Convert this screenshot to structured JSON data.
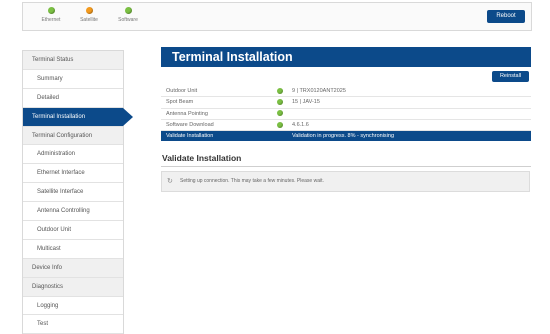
{
  "header": {
    "indicators": [
      {
        "label": "Ethernet",
        "color": "#7bc043"
      },
      {
        "label": "Satellite",
        "color": "#f39a1e"
      },
      {
        "label": "Software",
        "color": "#7bc043"
      }
    ],
    "reboot_label": "Reboot"
  },
  "sidebar": {
    "items": [
      {
        "label": "Terminal Status"
      },
      {
        "label": "Summary"
      },
      {
        "label": "Detailed"
      },
      {
        "label": "Terminal Installation"
      },
      {
        "label": "Terminal Configuration"
      },
      {
        "label": "Administration"
      },
      {
        "label": "Ethernet Interface"
      },
      {
        "label": "Satellite Interface"
      },
      {
        "label": "Antenna Controlling"
      },
      {
        "label": "Outdoor Unit"
      },
      {
        "label": "Multicast"
      },
      {
        "label": "Device Info"
      },
      {
        "label": "Diagnostics"
      },
      {
        "label": "Logging"
      },
      {
        "label": "Test"
      }
    ]
  },
  "main": {
    "title": "Terminal Installation",
    "reinstall_label": "Reinstall",
    "rows": [
      {
        "label": "Outdoor Unit",
        "value": "9 | TRX0120ANT2025",
        "status_color": "#7bc043"
      },
      {
        "label": "Spot Beam",
        "value": "15 | JAV-15",
        "status_color": "#7bc043"
      },
      {
        "label": "Antenna Pointing",
        "value": "",
        "status_color": "#7bc043"
      },
      {
        "label": "Software Download",
        "value": "4.6.1.6",
        "status_color": "#7bc043"
      },
      {
        "label": "Validate Installation",
        "value": "Validation in progress. 8% - synchronising"
      }
    ],
    "section_title": "Validate Installation",
    "message": "Setting up connection. This may take a few minutes. Please wait."
  }
}
